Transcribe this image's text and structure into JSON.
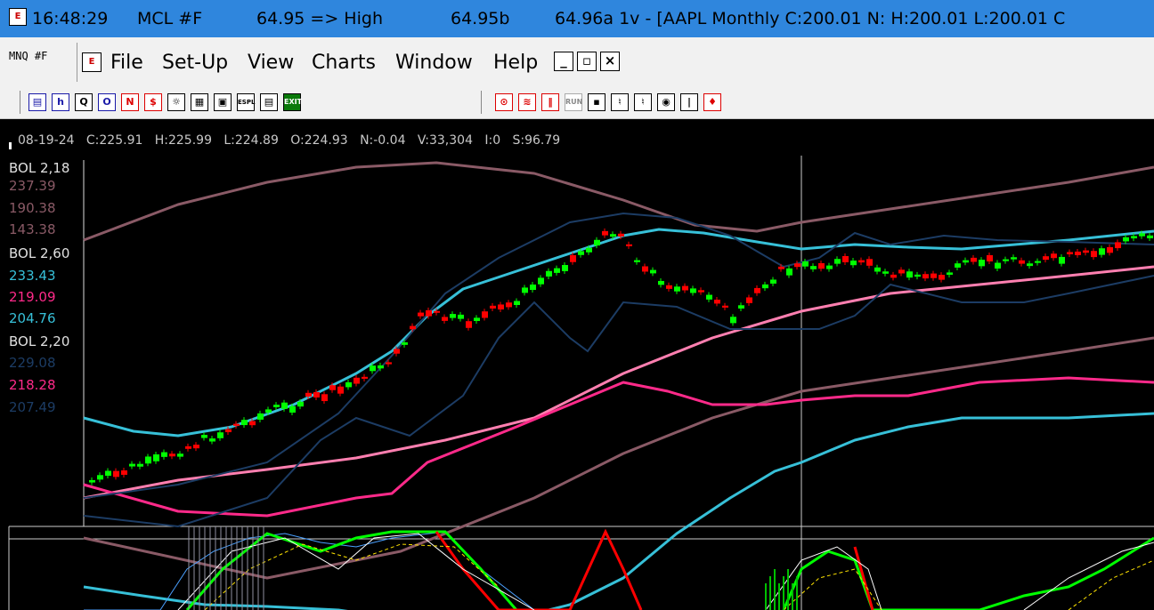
{
  "title": {
    "time": "16:48:29",
    "symbol": "MCL #F",
    "price_state": "64.95 => High",
    "bid": "64.95b",
    "ask_info": "64.96a  1v - [AAPL Monthly C:200.01 N: H:200.01 L:200.01 C"
  },
  "menu": {
    "symbol_label": "MNQ #F",
    "items": [
      "File",
      "Set-Up",
      "View",
      "Charts",
      "Window",
      "Help"
    ],
    "minimize": "_",
    "restore": "▫",
    "close": "×"
  },
  "toolbar": {
    "left_buttons": [
      "▤",
      "h",
      "Q",
      "O",
      "N",
      "$",
      "☼",
      "▦",
      "▣",
      "ESPL",
      "▤",
      "EXIT"
    ],
    "right_buttons": [
      "⊙",
      "≋",
      "‖",
      "RUN",
      "▪",
      "♮",
      "♮",
      "◉",
      "|",
      "♦"
    ]
  },
  "chart_info": {
    "date": "08-19-24",
    "close": "C:225.91",
    "high": "H:225.99",
    "low": "L:224.89",
    "open": "O:224.93",
    "net": "N:-0.04",
    "volume": "V:33,304",
    "oi": "I:0",
    "s": "S:96.79"
  },
  "legend": [
    {
      "label": "BOL  2,18",
      "color": "#e0e0e0",
      "values": [
        "237.39",
        "190.38",
        "143.38"
      ],
      "value_color": "#8a5a66"
    },
    {
      "label": "BOL  2,60",
      "color": "#e0e0e0",
      "values": [
        "233.43",
        "219.09",
        "204.76"
      ],
      "value_colors": [
        "#37c0d8",
        "#ff2a8a",
        "#37c0d8"
      ]
    },
    {
      "label": "BOL  2,20",
      "color": "#e0e0e0",
      "values": [
        "229.08",
        "218.28",
        "207.49"
      ],
      "value_colors": [
        "#1c3c64",
        "#ff2a8a",
        "#1c3c64"
      ]
    }
  ],
  "colors": {
    "titlebar": "#2f86dd",
    "chart_bg": "#000000",
    "up_candle": "#00ff00",
    "down_candle": "#ff0000",
    "band_long": "#8a5a66",
    "band_mid": "#37c0d8",
    "band_short": "#1c3c64",
    "mid_pink": "#ff2a8a",
    "mid_lightpink": "#ff7fb0"
  },
  "chart_data": {
    "type": "line",
    "series": [
      {
        "points": [
          [
            94,
            270
          ],
          [
            200,
            230
          ],
          [
            300,
            205
          ],
          [
            400,
            188
          ],
          [
            490,
            183
          ],
          [
            600,
            195
          ],
          [
            700,
            225
          ],
          [
            780,
            253
          ],
          [
            850,
            260
          ],
          [
            900,
            250
          ],
          [
            1000,
            235
          ],
          [
            1100,
            220
          ],
          [
            1200,
            205
          ],
          [
            1296,
            188
          ]
        ],
        "color": "#8a5a66"
      },
      {
        "points": [
          [
            94,
            605
          ],
          [
            300,
            650
          ],
          [
            450,
            620
          ],
          [
            600,
            560
          ],
          [
            700,
            510
          ],
          [
            800,
            470
          ],
          [
            900,
            440
          ],
          [
            1000,
            425
          ],
          [
            1100,
            410
          ],
          [
            1200,
            395
          ],
          [
            1296,
            380
          ]
        ],
        "color": "#8a5a66"
      },
      {
        "points": [
          [
            94,
            560
          ],
          [
            200,
            540
          ],
          [
            300,
            528
          ],
          [
            400,
            515
          ],
          [
            500,
            495
          ],
          [
            600,
            470
          ],
          [
            700,
            420
          ],
          [
            800,
            380
          ],
          [
            900,
            350
          ],
          [
            1000,
            330
          ],
          [
            1100,
            320
          ],
          [
            1200,
            310
          ],
          [
            1296,
            300
          ]
        ],
        "color": "#ff7fb0"
      },
      {
        "points": [
          [
            94,
            470
          ],
          [
            150,
            485
          ],
          [
            200,
            490
          ],
          [
            260,
            480
          ],
          [
            330,
            455
          ],
          [
            400,
            420
          ],
          [
            440,
            395
          ],
          [
            480,
            355
          ],
          [
            520,
            325
          ],
          [
            580,
            305
          ],
          [
            640,
            285
          ],
          [
            700,
            265
          ],
          [
            740,
            258
          ],
          [
            790,
            262
          ],
          [
            850,
            272
          ],
          [
            900,
            280
          ],
          [
            960,
            275
          ],
          [
            1020,
            278
          ],
          [
            1080,
            280
          ],
          [
            1140,
            275
          ],
          [
            1200,
            270
          ],
          [
            1296,
            260
          ]
        ],
        "color": "#37c0d8"
      },
      {
        "points": [
          [
            94,
            660
          ],
          [
            160,
            670
          ],
          [
            230,
            680
          ],
          [
            300,
            682
          ],
          [
            380,
            686
          ],
          [
            480,
            700
          ],
          [
            560,
            700
          ],
          [
            640,
            680
          ],
          [
            700,
            650
          ],
          [
            760,
            600
          ],
          [
            820,
            560
          ],
          [
            870,
            530
          ],
          [
            900,
            520
          ],
          [
            960,
            495
          ],
          [
            1020,
            480
          ],
          [
            1080,
            470
          ],
          [
            1140,
            470
          ],
          [
            1200,
            470
          ],
          [
            1296,
            465
          ]
        ],
        "color": "#37c0d8"
      },
      {
        "points": [
          [
            94,
            545
          ],
          [
            200,
            575
          ],
          [
            300,
            580
          ],
          [
            400,
            560
          ],
          [
            440,
            555
          ],
          [
            480,
            520
          ],
          [
            530,
            500
          ],
          [
            580,
            480
          ],
          [
            640,
            455
          ],
          [
            700,
            430
          ],
          [
            750,
            440
          ],
          [
            800,
            455
          ],
          [
            860,
            455
          ],
          [
            900,
            450
          ],
          [
            960,
            445
          ],
          [
            1020,
            445
          ],
          [
            1100,
            430
          ],
          [
            1200,
            425
          ],
          [
            1296,
            430
          ]
        ],
        "color": "#ff2a8a"
      }
    ]
  }
}
